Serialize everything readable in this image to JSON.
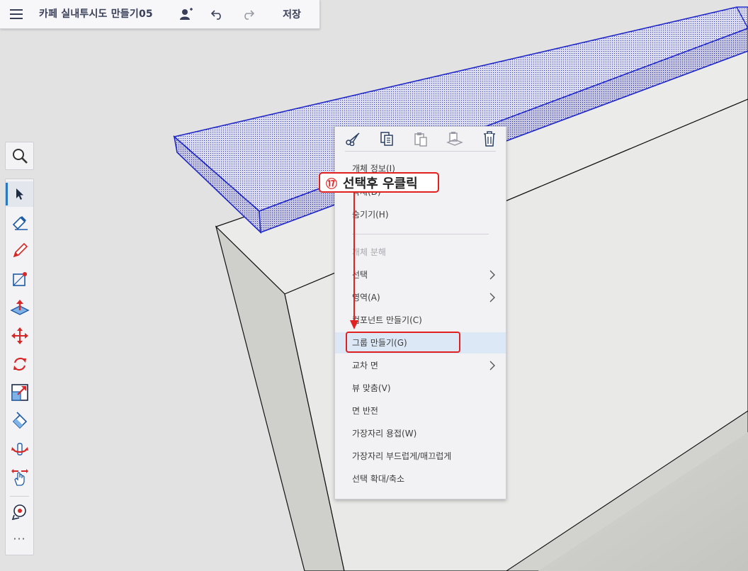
{
  "app": {
    "title": "카페 실내투시도 만들기05",
    "save_label": "저장"
  },
  "icons": {
    "menu": "hamburger-menu-icon",
    "share": "add-user-icon",
    "undo": "undo-icon",
    "redo": "redo-icon"
  },
  "toolbar": {
    "search": "magnifier-icon",
    "tools": [
      {
        "name": "select",
        "icon": "arrow-cursor-icon",
        "active": true
      },
      {
        "name": "eraser",
        "icon": "eraser-icon"
      },
      {
        "name": "pencil",
        "icon": "pencil-icon"
      },
      {
        "name": "rectangle",
        "icon": "rectangle-icon"
      },
      {
        "name": "push-pull",
        "icon": "push-pull-icon"
      },
      {
        "name": "move",
        "icon": "move-arrows-icon"
      },
      {
        "name": "rotate",
        "icon": "rotate-icon"
      },
      {
        "name": "scale",
        "icon": "scale-icon"
      },
      {
        "name": "paint",
        "icon": "paint-bucket-icon"
      },
      {
        "name": "orbit",
        "icon": "orbit-icon"
      },
      {
        "name": "pan",
        "icon": "pan-hand-icon"
      },
      {
        "name": "tape",
        "icon": "tape-measure-icon"
      }
    ],
    "more_label": "···"
  },
  "context_menu": {
    "actions": [
      "cut-icon",
      "copy-icon",
      "paste-icon",
      "paste-in-place-icon",
      "delete-icon"
    ],
    "items": [
      {
        "label": "개체 정보(I)",
        "enabled": true
      },
      {
        "label": "삭제(D)",
        "enabled": true
      },
      {
        "label": "숨기기(H)",
        "enabled": true
      },
      {
        "label": "개체 분해",
        "enabled": false
      },
      {
        "label": "선택",
        "enabled": true,
        "submenu": true
      },
      {
        "label": "영역(A)",
        "enabled": true,
        "submenu": true
      },
      {
        "label": "컴포넌트 만들기(C)",
        "enabled": true
      },
      {
        "label": "그룹 만들기(G)",
        "enabled": true,
        "highlighted": true
      },
      {
        "label": "교차 면",
        "enabled": true,
        "submenu": true
      },
      {
        "label": "뷰 맞춤(V)",
        "enabled": true
      },
      {
        "label": "면 반전",
        "enabled": true
      },
      {
        "label": "가장자리 용접(W)",
        "enabled": true
      },
      {
        "label": "가장자리 부드럽게/매끄럽게",
        "enabled": true
      },
      {
        "label": "선택 확대/축소",
        "enabled": true
      }
    ]
  },
  "annotation": {
    "number": "⑰",
    "text": "선택후 우클릭"
  },
  "colors": {
    "accent": "#2a78c2",
    "selection": "#1f27c8",
    "annotation": "#e12020",
    "highlight_row": "#dde8f6"
  }
}
